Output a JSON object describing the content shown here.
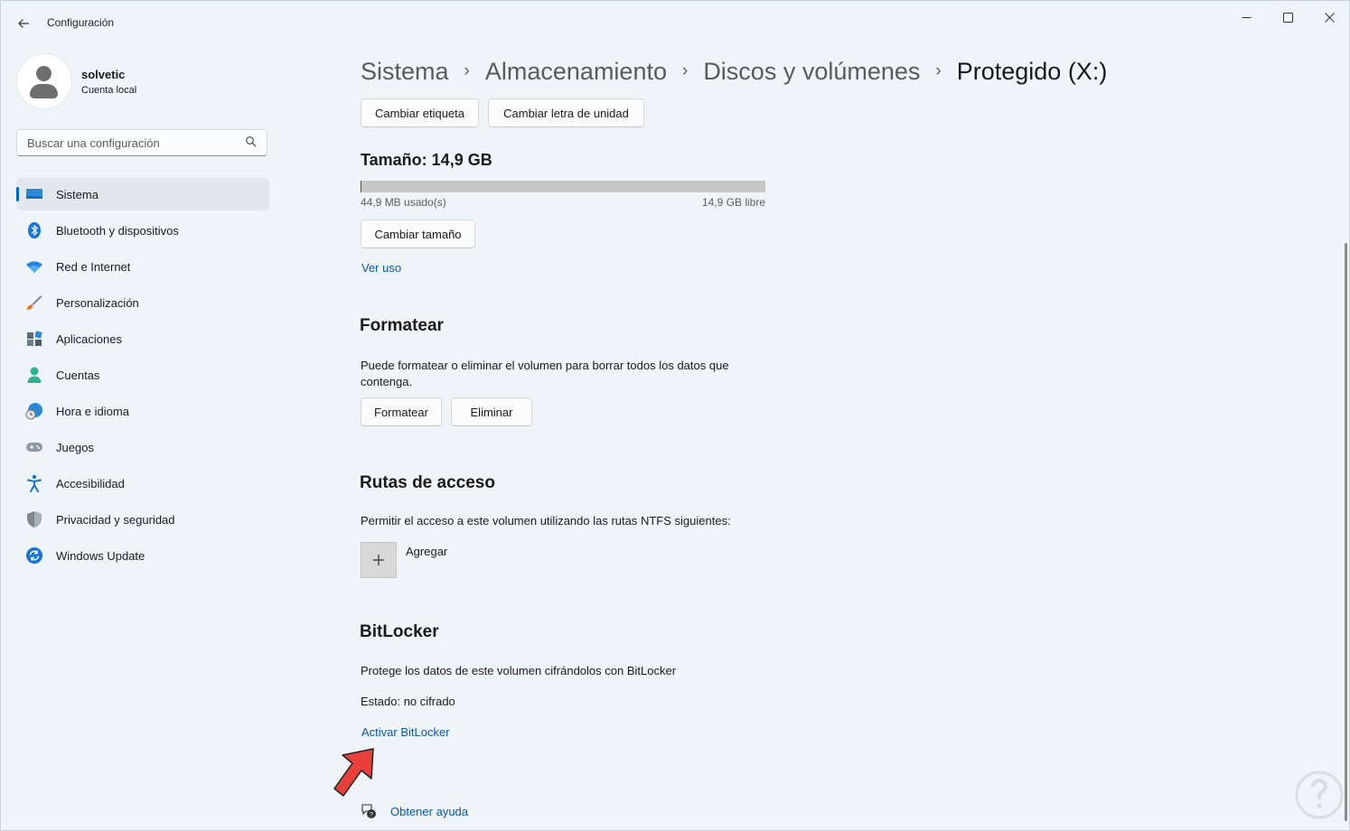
{
  "window": {
    "title": "Configuración",
    "controls": {
      "minimize": "minimize-icon",
      "maximize": "maximize-icon",
      "close": "close-icon"
    }
  },
  "user": {
    "name": "solvetic",
    "account_type": "Cuenta local"
  },
  "search": {
    "placeholder": "Buscar una configuración",
    "value": ""
  },
  "sidebar": {
    "items": [
      {
        "label": "Sistema",
        "icon": "monitor-icon",
        "active": true
      },
      {
        "label": "Bluetooth y dispositivos",
        "icon": "bluetooth-icon"
      },
      {
        "label": "Red e Internet",
        "icon": "wifi-icon"
      },
      {
        "label": "Personalización",
        "icon": "brush-icon"
      },
      {
        "label": "Aplicaciones",
        "icon": "apps-icon"
      },
      {
        "label": "Cuentas",
        "icon": "person-icon"
      },
      {
        "label": "Hora e idioma",
        "icon": "globe-clock-icon"
      },
      {
        "label": "Juegos",
        "icon": "gamepad-icon"
      },
      {
        "label": "Accesibilidad",
        "icon": "accessibility-icon"
      },
      {
        "label": "Privacidad y seguridad",
        "icon": "shield-icon"
      },
      {
        "label": "Windows Update",
        "icon": "update-icon"
      }
    ]
  },
  "breadcrumb": {
    "items": [
      "Sistema",
      "Almacenamiento",
      "Discos y volúmenes",
      "Protegido (X:)"
    ],
    "separator": "›"
  },
  "actions": {
    "change_label": "Cambiar etiqueta",
    "change_letter": "Cambiar letra de unidad"
  },
  "size": {
    "title": "Tamaño: 14,9 GB",
    "used": "44,9 MB usado(s)",
    "free": "14,9 GB libre",
    "used_fraction": 0.003,
    "resize_button": "Cambiar tamaño",
    "view_usage": "Ver uso"
  },
  "format": {
    "heading": "Formatear",
    "description": "Puede formatear o eliminar el volumen para borrar todos los datos que contenga.",
    "format_button": "Formatear",
    "delete_button": "Eliminar"
  },
  "paths": {
    "heading": "Rutas de acceso",
    "description": "Permitir el acceso a este volumen utilizando las rutas NTFS siguientes:",
    "add_label": "Agregar"
  },
  "bitlocker": {
    "heading": "BitLocker",
    "description": "Protege los datos de este volumen cifrándolos con BitLocker",
    "status": "Estado: no cifrado",
    "activate_link": "Activar BitLocker"
  },
  "help": {
    "label": "Obtener ayuda"
  },
  "colors": {
    "accent": "#0067c0",
    "link": "#0a56b0",
    "background": "#eff4f9",
    "arrow": "#e8413b"
  }
}
